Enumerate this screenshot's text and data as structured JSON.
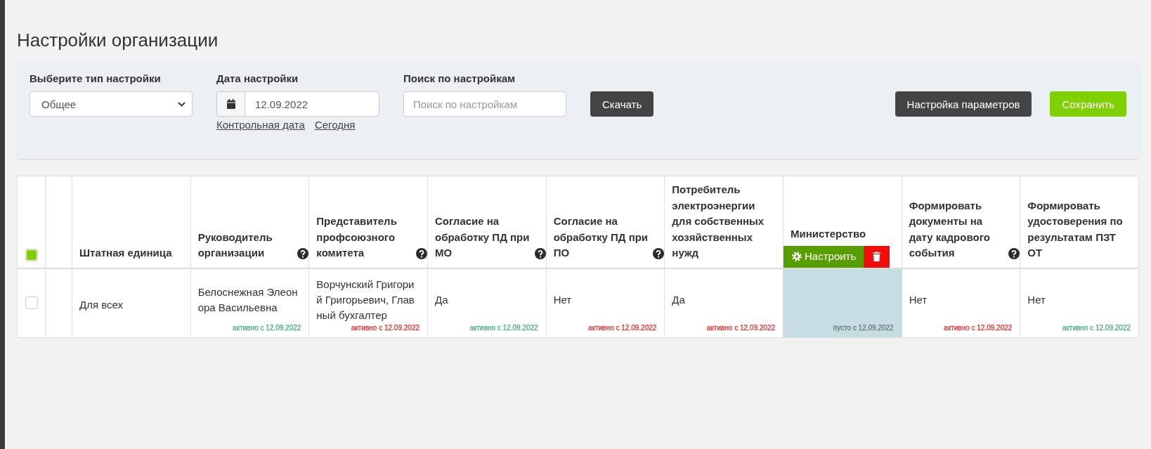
{
  "page": {
    "title": "Настройки организации"
  },
  "filters": {
    "setting_type": {
      "label": "Выберите тип настройки",
      "value": "Общее"
    },
    "setting_date": {
      "label": "Дата настройки",
      "value": "12.09.2022",
      "links": [
        "Контрольная дата",
        "Сегодня"
      ]
    },
    "search": {
      "label": "Поиск по настройкам",
      "placeholder": "Поиск по настройкам"
    },
    "buttons": [
      {
        "label": "Скачать",
        "kind": "dark"
      },
      {
        "label": "Настройка параметров",
        "kind": "dark"
      },
      {
        "label": "Сохранить",
        "kind": "success"
      }
    ]
  },
  "table": {
    "select_all": {
      "checked": true
    },
    "columns": [
      {
        "label": "Штатная единица",
        "help": false
      },
      {
        "label": "Руководитель организации",
        "help": true
      },
      {
        "label": "Представитель профсоюзного комитета",
        "help": true
      },
      {
        "label": "Согласие на обработку ПД при МО",
        "help": true
      },
      {
        "label": "Согласие на обработку ПД при ПО",
        "help": true
      },
      {
        "label": "Потребитель электроэнергии для собственных хозяйственных нужд",
        "help": false
      },
      {
        "label": "Министерство",
        "help": false,
        "buttons": [
          {
            "kind": "configure",
            "label": "Настроить"
          },
          {
            "kind": "delete"
          }
        ]
      },
      {
        "label": "Формировать документы на дату кадрового события",
        "help": true
      },
      {
        "label": "Формировать удостоверения по результатам ПЗТ ОТ",
        "help": false
      }
    ],
    "rows": [
      {
        "checked": false,
        "cells": [
          {
            "value": "Для всех",
            "highlighted": false
          },
          {
            "value": "Белоснежная Элеонора Васильевна",
            "status": "активно с 12.09.2022",
            "color": "#4fb088",
            "highlighted": false
          },
          {
            "value": "Ворчунский Григорий Григорьевич, Главный бухгалтер",
            "status": "активно с 12.09.2022",
            "color": "#e63a34",
            "highlighted": false
          },
          {
            "value": "Да",
            "status": "активно с 12.09.2022",
            "color": "#4fb088",
            "highlighted": false
          },
          {
            "value": "Нет",
            "status": "активно с 12.09.2022",
            "color": "#e63a34",
            "highlighted": false
          },
          {
            "value": "Да",
            "status": "активно с 12.09.2022",
            "color": "#e63a34",
            "highlighted": false
          },
          {
            "status": "пусто с 12.09.2022",
            "color": "#707a80",
            "highlighted": true
          },
          {
            "value": "Нет",
            "status": "активно с 12.09.2022",
            "color": "#e63a34",
            "highlighted": false
          },
          {
            "value": "Нет",
            "status": "активно с 12.09.2022",
            "color": "#4fb088",
            "highlighted": false
          }
        ]
      }
    ]
  }
}
